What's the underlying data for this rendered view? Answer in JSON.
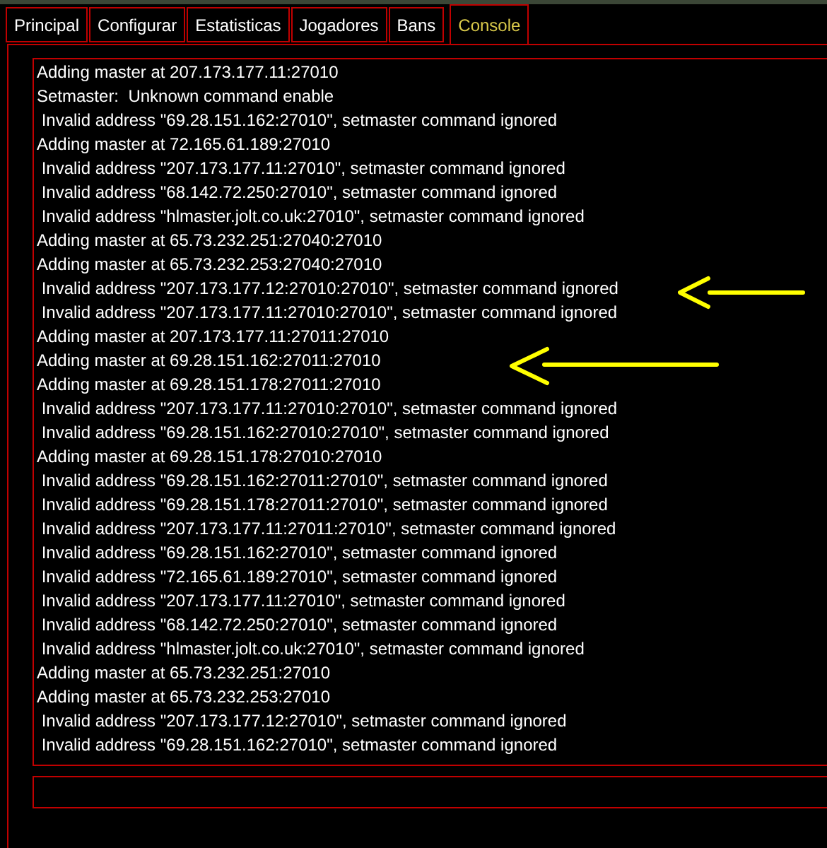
{
  "tabs": [
    {
      "label": "Principal",
      "selected": false
    },
    {
      "label": "Configurar",
      "selected": false
    },
    {
      "label": "Estatisticas",
      "selected": false
    },
    {
      "label": "Jogadores",
      "selected": false
    },
    {
      "label": "Bans",
      "selected": false
    },
    {
      "label": "Console",
      "selected": true
    }
  ],
  "console": {
    "lines": [
      "Adding master at 207.173.177.11:27010",
      "Setmaster:  Unknown command enable",
      " Invalid address \"69.28.151.162:27010\", setmaster command ignored",
      "Adding master at 72.165.61.189:27010",
      " Invalid address \"207.173.177.11:27010\", setmaster command ignored",
      " Invalid address \"68.142.72.250:27010\", setmaster command ignored",
      " Invalid address \"hlmaster.jolt.co.uk:27010\", setmaster command ignored",
      "Adding master at 65.73.232.251:27040:27010",
      "Adding master at 65.73.232.253:27040:27010",
      " Invalid address \"207.173.177.12:27010:27010\", setmaster command ignored",
      " Invalid address \"207.173.177.11:27010:27010\", setmaster command ignored",
      "Adding master at 207.173.177.11:27011:27010",
      "Adding master at 69.28.151.162:27011:27010",
      "Adding master at 69.28.151.178:27011:27010",
      " Invalid address \"207.173.177.11:27010:27010\", setmaster command ignored",
      " Invalid address \"69.28.151.162:27010:27010\", setmaster command ignored",
      "Adding master at 69.28.151.178:27010:27010",
      " Invalid address \"69.28.151.162:27011:27010\", setmaster command ignored",
      " Invalid address \"69.28.151.178:27011:27010\", setmaster command ignored",
      " Invalid address \"207.173.177.11:27011:27010\", setmaster command ignored",
      " Invalid address \"69.28.151.162:27010\", setmaster command ignored",
      " Invalid address \"72.165.61.189:27010\", setmaster command ignored",
      " Invalid address \"207.173.177.11:27010\", setmaster command ignored",
      " Invalid address \"68.142.72.250:27010\", setmaster command ignored",
      " Invalid address \"hlmaster.jolt.co.uk:27010\", setmaster command ignored",
      "Adding master at 65.73.232.251:27010",
      "Adding master at 65.73.232.253:27010",
      " Invalid address \"207.173.177.12:27010\", setmaster command ignored",
      " Invalid address \"69.28.151.162:27010\", setmaster command ignored"
    ]
  }
}
